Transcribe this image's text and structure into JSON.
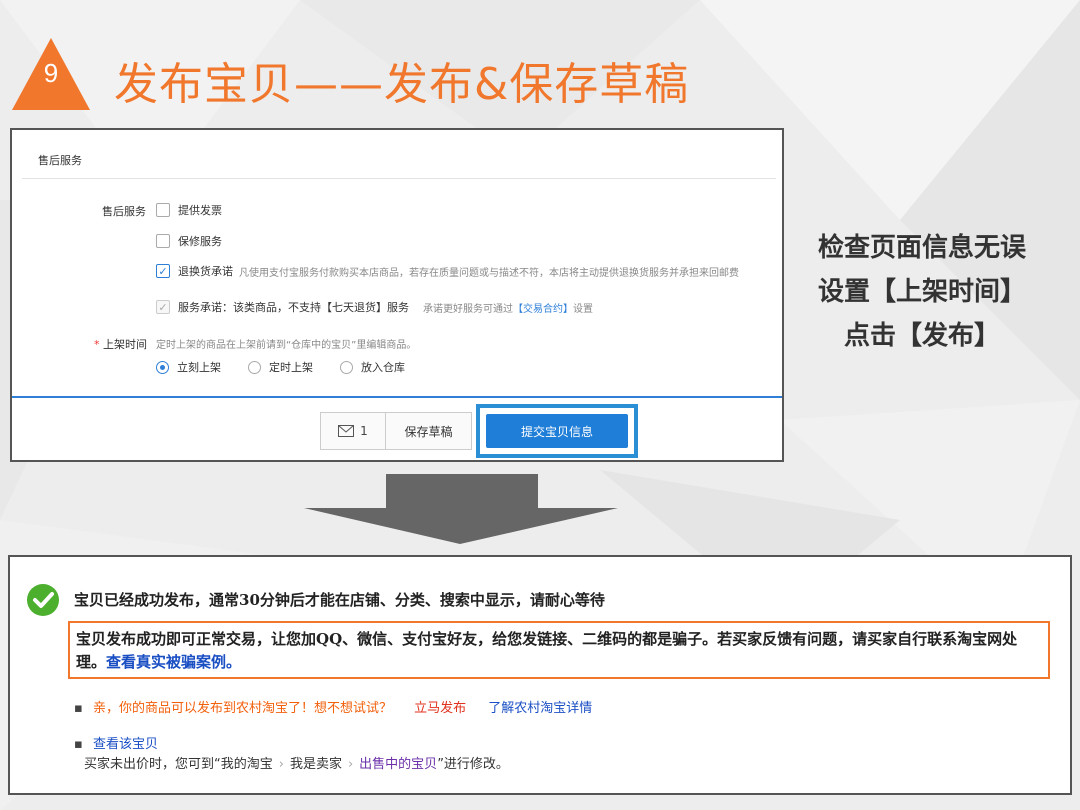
{
  "colors": {
    "accent_orange": "#f0772c",
    "primary_blue": "#1f7ed8",
    "highlight_blue": "#2b8fd6",
    "success_green": "#4caf2d",
    "arrow_gray": "#666666"
  },
  "header": {
    "step_number": "9",
    "title": "发布宝贝——发布&保存草稿"
  },
  "form": {
    "section_title": "售后服务",
    "after_sales_label": "售后服务",
    "options": {
      "invoice": "提供发票",
      "warranty": "保修服务",
      "return_label": "退换货承诺",
      "return_desc": "凡使用支付宝服务付款购买本店商品，若存在质量问题或与描述不符，本店将主动提供退换货服务并承担来回邮费",
      "service_label": "服务承诺：该类商品，不支持【七天退货】服务",
      "service_desc_prefix": "承诺更好服务可通过",
      "service_link": "【交易合约】",
      "service_desc_suffix": "设置"
    },
    "onshelf": {
      "required_mark": "*",
      "label": "上架时间",
      "hint": "定时上架的商品在上架前请到“仓库中的宝贝”里编辑商品。",
      "choices": [
        "立刻上架",
        "定时上架",
        "放入仓库"
      ]
    },
    "buttons": {
      "message_count": "1",
      "save_draft": "保存草稿",
      "submit": "提交宝贝信息"
    }
  },
  "side_note": {
    "line1": "检查页面信息无误",
    "line2": "设置【上架时间】",
    "line3": "点击【发布】"
  },
  "result": {
    "success_message": "宝贝已经成功发布，通常30分钟后才能在店铺、分类、搜索中显示，请耐心等待",
    "warning_text": "宝贝发布成功即可正常交易，让您加QQ、微信、支付宝好友，给您发链接、二维码的都是骗子。若买家反馈有问题，请买家自行联系淘宝网处理。",
    "warning_link": "查看真实被骗案例。",
    "promo_text": "亲，你的商品可以发布到农村淘宝了！想不想试试？",
    "promo_publish": "立马发布",
    "promo_learn": "了解农村淘宝详情",
    "view_item": "查看该宝贝",
    "edit_prefix": "买家未出价时，您可到“我的淘宝",
    "edit_seller": "我是卖家",
    "edit_onsale": "出售中的宝贝",
    "edit_suffix": "”进行修改。"
  }
}
